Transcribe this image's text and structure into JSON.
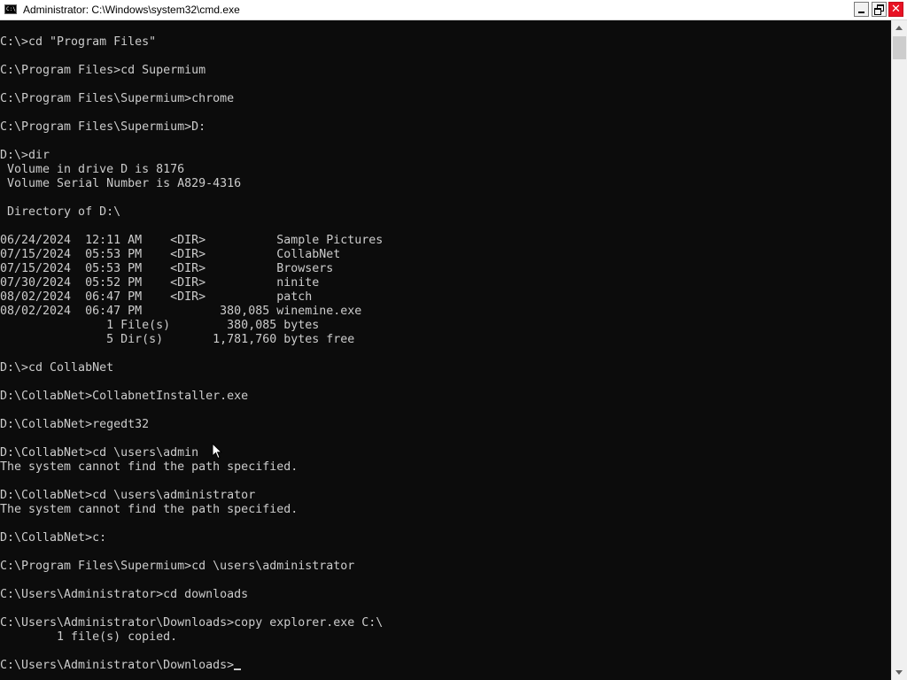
{
  "window": {
    "title": "Administrator: C:\\Windows\\system32\\cmd.exe",
    "icon": "cmd-icon",
    "icon_text": "C:\\"
  },
  "titlebar_buttons": {
    "minimize": "minimize-icon",
    "maximize": "restore-icon",
    "close": "close-icon",
    "close_glyph": "✕"
  },
  "colors": {
    "console_background": "#0c0c0c",
    "console_text": "#cccccc",
    "close_button": "#e81123"
  },
  "console": {
    "lines": [
      "C:\\>cd \"Program Files\"",
      "",
      "C:\\Program Files>cd Supermium",
      "",
      "C:\\Program Files\\Supermium>chrome",
      "",
      "C:\\Program Files\\Supermium>D:",
      "",
      "D:\\>dir",
      " Volume in drive D is 8176",
      " Volume Serial Number is A829-4316",
      "",
      " Directory of D:\\",
      "",
      "06/24/2024  12:11 AM    <DIR>          Sample Pictures",
      "07/15/2024  05:53 PM    <DIR>          CollabNet",
      "07/15/2024  05:53 PM    <DIR>          Browsers",
      "07/30/2024  05:52 PM    <DIR>          ninite",
      "08/02/2024  06:47 PM    <DIR>          patch",
      "08/02/2024  06:47 PM           380,085 winemine.exe",
      "               1 File(s)        380,085 bytes",
      "               5 Dir(s)       1,781,760 bytes free",
      "",
      "D:\\>cd CollabNet",
      "",
      "D:\\CollabNet>CollabnetInstaller.exe",
      "",
      "D:\\CollabNet>regedt32",
      "",
      "D:\\CollabNet>cd \\users\\admin",
      "The system cannot find the path specified.",
      "",
      "D:\\CollabNet>cd \\users\\administrator",
      "The system cannot find the path specified.",
      "",
      "D:\\CollabNet>c:",
      "",
      "C:\\Program Files\\Supermium>cd \\users\\administrator",
      "",
      "C:\\Users\\Administrator>cd downloads",
      "",
      "C:\\Users\\Administrator\\Downloads>copy explorer.exe C:\\",
      "        1 file(s) copied.",
      ""
    ],
    "prompt": "C:\\Users\\Administrator\\Downloads>"
  },
  "scrollbar": {
    "up_icon": "scroll-up-arrow-icon",
    "down_icon": "scroll-down-arrow-icon"
  },
  "cursor": {
    "icon": "mouse-pointer-icon"
  }
}
